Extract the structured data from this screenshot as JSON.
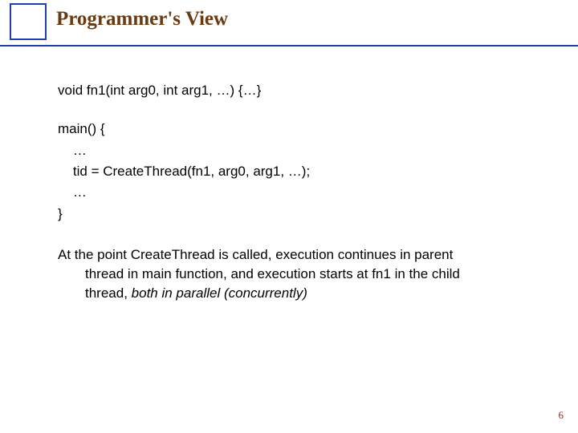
{
  "title": "Programmer's View",
  "code": {
    "line1": "void fn1(int arg0, int arg1, …) {…}",
    "main_open": "main() {",
    "ell1": "    …",
    "tid": "    tid = CreateThread(fn1, arg0, arg1, …);",
    "ell2": "    …",
    "main_close": "}"
  },
  "note": {
    "line1": "At the point CreateThread is called, execution continues in parent",
    "line2": "thread in main function, and execution starts at fn1 in the child",
    "line3_pre": "thread, ",
    "line3_em": "both in parallel  (concurrently)"
  },
  "page_number": "6"
}
